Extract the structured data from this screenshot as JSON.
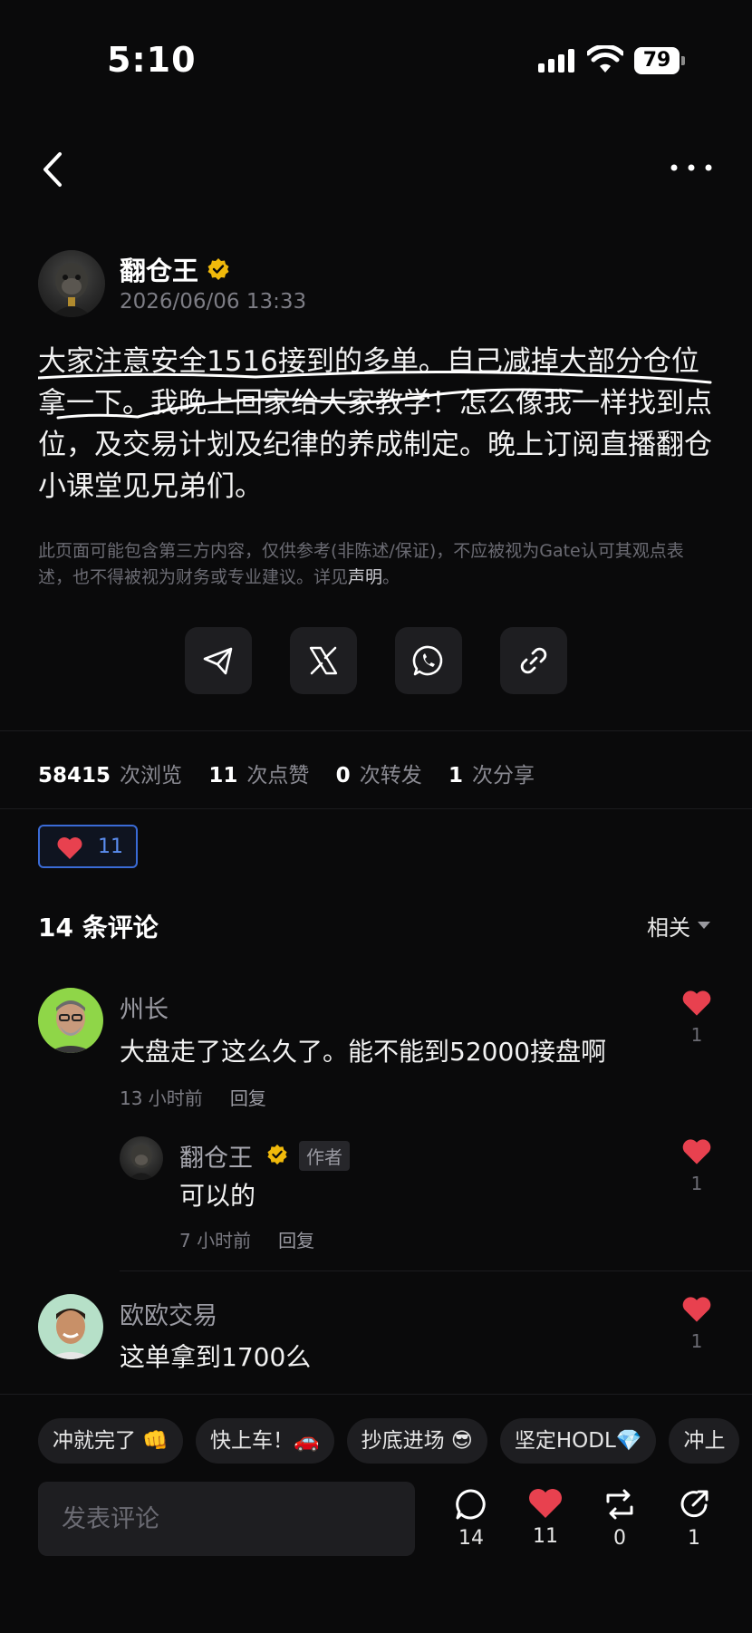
{
  "status_bar": {
    "time": "5:10",
    "battery": "79"
  },
  "post": {
    "author": "翻仓王",
    "date": "2026/06/06 13:33",
    "body_lines": [
      "大家注意安全1516接到的多单。自己减掉大部分仓位",
      "拿一下。我晚上回家给大家教学！怎么像我一样找到点",
      "位，及交易计划及纪律的养成制定。晚上订阅直播翻仓",
      "小课堂见兄弟们。"
    ],
    "disclaimer_text": "此页面可能包含第三方内容，仅供参考(非陈述/保证)，不应被视为Gate认可其观点表述，也不得被视为财务或专业建议。详见",
    "disclaimer_link": "声明",
    "disclaimer_end": "。"
  },
  "share": {
    "icons": [
      "telegram-icon",
      "x-icon",
      "whatsapp-icon",
      "link-icon"
    ]
  },
  "stats": {
    "views": "58415",
    "views_label": "次浏览",
    "likes": "11",
    "likes_label": "次点赞",
    "reposts": "0",
    "reposts_label": "次转发",
    "shares": "1",
    "shares_label": "次分享"
  },
  "like_pill": {
    "count": "11"
  },
  "comments": {
    "title": "14 条评论",
    "sort": "相关",
    "items": [
      {
        "name": "州长",
        "text": "大盘走了这么久了。能不能到52000接盘啊",
        "time": "13 小时前",
        "reply": "回复",
        "likes": "1"
      },
      {
        "name": "翻仓王",
        "tag": "作者",
        "text": "可以的",
        "time": "7 小时前",
        "reply": "回复",
        "likes": "1"
      },
      {
        "name": "欧欧交易",
        "text": "这单拿到1700么",
        "likes": "1"
      }
    ]
  },
  "bottom": {
    "chips": [
      "冲就完了 👊",
      "快上车！🚗",
      "抄底进场 😎",
      "坚定HODL💎",
      "冲上"
    ],
    "input_placeholder": "发表评论",
    "comment_count": "14",
    "like_count": "11",
    "repost_count": "0",
    "share_count": "1"
  },
  "colors": {
    "accent_blue": "#3a6bd6",
    "like_red": "#e8414f",
    "verified_gold": "#f0b90b"
  }
}
